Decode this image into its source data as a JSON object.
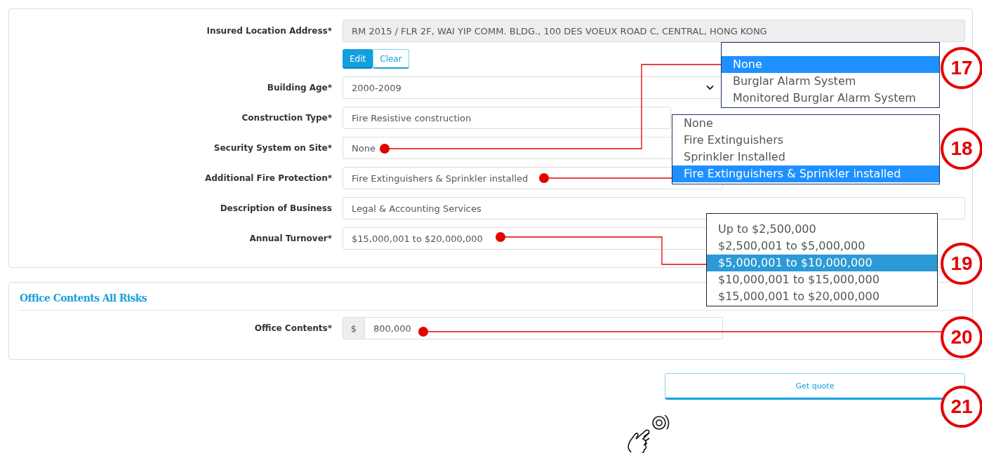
{
  "details": {
    "fields": [
      {
        "label": "Insured Location Address*",
        "value": "RM 2015 / FLR 2F, WAI YIP COMM. BLDG., 100 DES VOEUX ROAD C, CENTRAL, HONG KONG",
        "kind": "readonly",
        "buttons": [
          {
            "label": "Edit",
            "kind": "primary"
          },
          {
            "label": "Clear",
            "kind": "outline"
          }
        ]
      },
      {
        "label": "Building Age*",
        "value": "2000-2009",
        "kind": "select"
      },
      {
        "label": "Construction Type*",
        "value": "Fire Resistive construction",
        "kind": "text"
      },
      {
        "label": "Security System on Site*",
        "value": "None",
        "kind": "text"
      },
      {
        "label": "Additional Fire Protection*",
        "value": "Fire Extinguishers & Sprinkler installed",
        "kind": "text"
      },
      {
        "label": "Description of Business",
        "value": "Legal & Accounting Services",
        "kind": "text"
      },
      {
        "label": "Annual Turnover*",
        "value": "$15,000,001 to $20,000,000",
        "kind": "text"
      }
    ]
  },
  "office_contents": {
    "title": "Office Contents All Risks",
    "fields": [
      {
        "label": "Office Contents*",
        "prefix": "$",
        "value": "800,000",
        "kind": "currency"
      }
    ]
  },
  "get_quote_button": "Get quote",
  "dropdowns": [
    {
      "options": [
        {
          "label": "None",
          "selected": true
        },
        {
          "label": "Burglar Alarm System",
          "selected": false
        },
        {
          "label": "Monitored Burglar Alarm System",
          "selected": false
        }
      ]
    },
    {
      "options": [
        {
          "label": "None",
          "selected": false
        },
        {
          "label": "Fire Extinguishers",
          "selected": false
        },
        {
          "label": "Sprinkler Installed",
          "selected": false
        },
        {
          "label": "Fire Extinguishers & Sprinkler installed",
          "selected": true
        }
      ]
    },
    {
      "options": [
        {
          "label": "Up to $2,500,000",
          "selected": false
        },
        {
          "label": "$2,500,001 to $5,000,000",
          "selected": false
        },
        {
          "label": "$5,000,001 to $10,000,000",
          "selected": true
        },
        {
          "label": "$10,000,001 to $15,000,000",
          "selected": false
        },
        {
          "label": "$15,000,001 to $20,000,000",
          "selected": false
        }
      ]
    }
  ],
  "callouts": [
    {
      "number": "17"
    },
    {
      "number": "18"
    },
    {
      "number": "19"
    },
    {
      "number": "20"
    },
    {
      "number": "21"
    }
  ]
}
